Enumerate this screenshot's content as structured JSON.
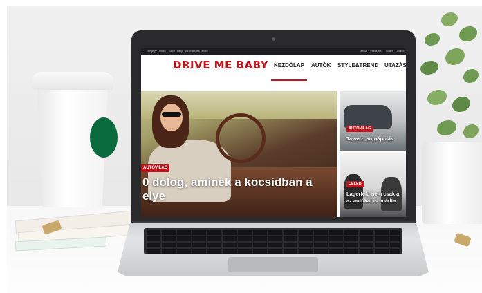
{
  "browser_bar": {
    "items": [
      "Névjegy",
      "Undo",
      "Save",
      "Help",
      "All changes saved"
    ],
    "right_items": [
      "Media + Press Kit",
      "Share",
      "Olvasd"
    ]
  },
  "site": {
    "logo": "DRIVE ME BABY",
    "nav": [
      "KEZDŐLAP",
      "AUTÓK",
      "STYLE&TREND",
      "UTAZÁS"
    ],
    "active_nav": "KEZDŐLAP"
  },
  "hero": {
    "tag": "AUTÓVILÁG",
    "title_line1": "0 dolog, aminek a kocsidban a",
    "title_line2": "elye"
  },
  "cards": [
    {
      "tag": "AUTÓVILÁG",
      "title": "Tavaszi autóápolás"
    },
    {
      "tag": "CELEB",
      "title_line1": "Lagerfeld nem csak a",
      "title_line2": "az autókat is imádta"
    }
  ],
  "colors": {
    "brand_red": "#c0151c",
    "laptop_bezel": "#2a2a2c"
  }
}
